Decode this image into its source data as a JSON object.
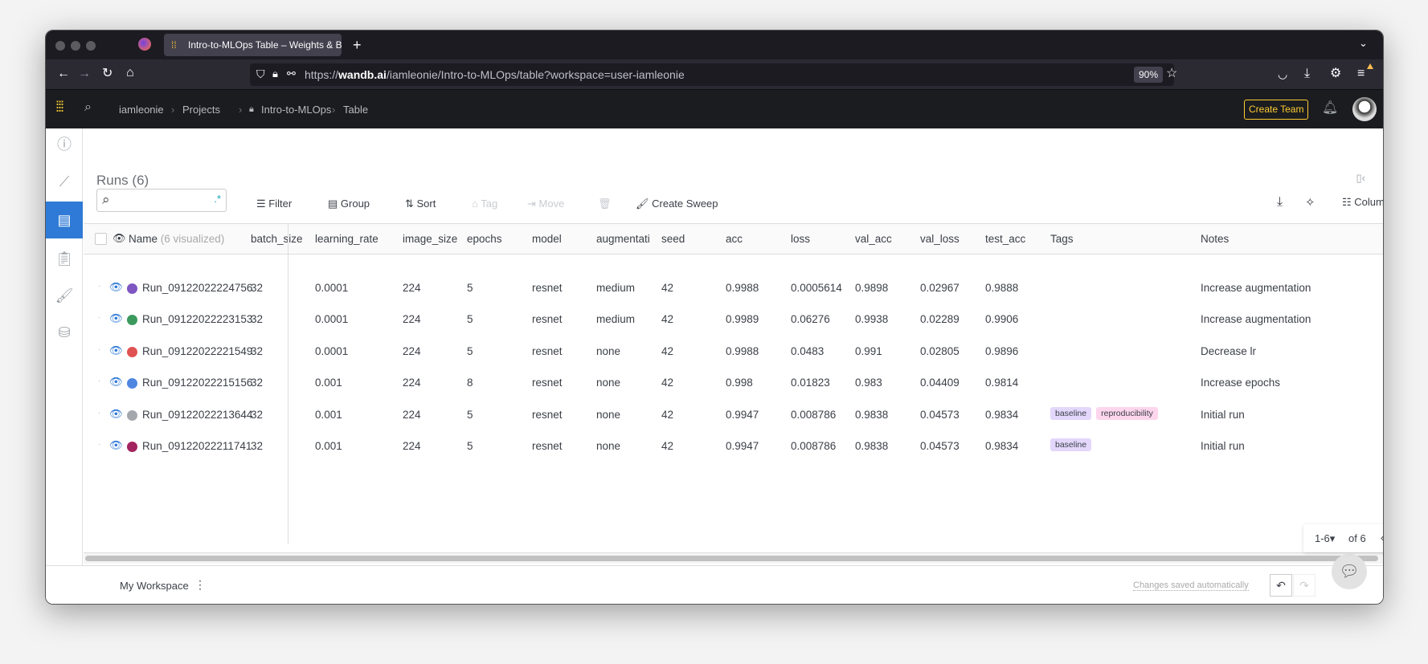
{
  "browser": {
    "tab_title": "Intro-to-MLOps Table – Weights & Biases",
    "url_prefix": "https://",
    "url_domain": "wandb.ai",
    "url_path": "/iamleonie/Intro-to-MLOps/table?workspace=user-iamleonie",
    "zoom": "90%",
    "new_tab": "+"
  },
  "header": {
    "breadcrumb": [
      "iamleonie",
      "Projects",
      "Intro-to-MLOps",
      "Table"
    ],
    "create_team": "Create Team",
    "accent": "#ffcc33"
  },
  "panel": {
    "title": "Runs (6)",
    "search_placeholder": "",
    "regex": ".*",
    "filter": "Filter",
    "group": "Group",
    "sort": "Sort",
    "tag": "Tag",
    "move": "Move",
    "create_sweep": "Create Sweep",
    "columns": "Columns"
  },
  "table": {
    "name_header": "Name",
    "visualized": "(6 visualized)",
    "columns": [
      "batch_size",
      "learning_rate",
      "image_size",
      "epochs",
      "model",
      "augmentati",
      "seed",
      "acc",
      "loss",
      "val_acc",
      "val_loss",
      "test_acc",
      "Tags",
      "Notes"
    ],
    "rows": [
      {
        "name": "Run_09122022224756",
        "color": "#7e57c2",
        "values": [
          "32",
          "0.0001",
          "224",
          "5",
          "resnet",
          "medium",
          "42",
          "0.9988",
          "0.0005614",
          "0.9898",
          "0.02967",
          "0.9888"
        ],
        "tags": [],
        "notes": "Increase augmentation"
      },
      {
        "name": "Run_09122022223153",
        "color": "#3c9a5f",
        "values": [
          "32",
          "0.0001",
          "224",
          "5",
          "resnet",
          "medium",
          "42",
          "0.9989",
          "0.06276",
          "0.9938",
          "0.02289",
          "0.9906"
        ],
        "tags": [],
        "notes": "Increase augmentation"
      },
      {
        "name": "Run_09122022221549",
        "color": "#e05252",
        "values": [
          "32",
          "0.0001",
          "224",
          "5",
          "resnet",
          "none",
          "42",
          "0.9988",
          "0.0483",
          "0.991",
          "0.02805",
          "0.9896"
        ],
        "tags": [],
        "notes": "Decrease lr"
      },
      {
        "name": "Run_09122022215156",
        "color": "#4f86e0",
        "values": [
          "32",
          "0.001",
          "224",
          "8",
          "resnet",
          "none",
          "42",
          "0.998",
          "0.01823",
          "0.983",
          "0.04409",
          "0.9814"
        ],
        "tags": [],
        "notes": "Increase epochs"
      },
      {
        "name": "Run_09122022213644",
        "color": "#a4a8ad",
        "values": [
          "32",
          "0.001",
          "224",
          "5",
          "resnet",
          "none",
          "42",
          "0.9947",
          "0.008786",
          "0.9838",
          "0.04573",
          "0.9834"
        ],
        "tags": [
          "baseline",
          "reproducibility"
        ],
        "notes": "Initial run"
      },
      {
        "name": "Run_09122022211741",
        "color": "#a3245f",
        "values": [
          "32",
          "0.001",
          "224",
          "5",
          "resnet",
          "none",
          "42",
          "0.9947",
          "0.008786",
          "0.9838",
          "0.04573",
          "0.9834"
        ],
        "tags": [
          "baseline"
        ],
        "notes": "Initial run"
      }
    ]
  },
  "pagination": {
    "range": "1-6",
    "of": "of 6"
  },
  "footer": {
    "workspace": "My Workspace",
    "saved": "Changes saved automatically"
  }
}
